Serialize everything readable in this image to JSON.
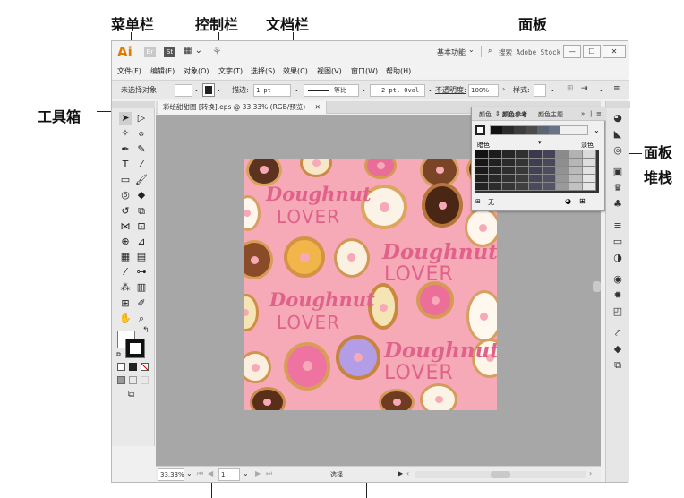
{
  "callouts": {
    "menubar": "菜单栏",
    "controlbar": "控制栏",
    "docbar": "文档栏",
    "panel": "面板",
    "toolbox": "工具箱",
    "panel_stack_1": "面板",
    "panel_stack_2": "堆栈"
  },
  "titlebar": {
    "logo": "Ai",
    "br": "Br",
    "st": "St",
    "workspace": "基本功能",
    "search_placeholder": "搜索 Adobe Stock",
    "minimize": "—",
    "maximize": "☐",
    "close": "✕"
  },
  "menu": {
    "items": [
      "文件(F)",
      "编辑(E)",
      "对象(O)",
      "文字(T)",
      "选择(S)",
      "效果(C)",
      "视图(V)",
      "窗口(W)",
      "帮助(H)"
    ]
  },
  "controlbar": {
    "selection": "未选择对象",
    "stroke_label": "描边:",
    "stroke_value": "1 pt",
    "uniform": "等比",
    "profile": "2 pt. Oval",
    "opacity_label": "不透明度:",
    "opacity_value": "100%",
    "style_label": "样式:"
  },
  "document": {
    "tab_title": "彩绘甜甜圈 [转换].eps @ 33.33% (RGB/预览)",
    "tab_close": "✕",
    "artwork_words": [
      "Doughnut",
      "LOVER",
      "Doughnut",
      "LOVER",
      "Doughnut",
      "LOVER",
      "Doughnut",
      "LOVER"
    ]
  },
  "statusbar": {
    "zoom": "33.33%",
    "page": "1",
    "tool": "选择"
  },
  "color_panel": {
    "tabs": [
      "颜色",
      "颜色参考",
      "颜色主题"
    ],
    "dark_label": "暗色",
    "light_label": "淡色",
    "none_label": "无"
  },
  "colors": {
    "artboard": "#f6a9b6",
    "pink_text": "#e0628a",
    "canvas": "#a7a7a7"
  }
}
